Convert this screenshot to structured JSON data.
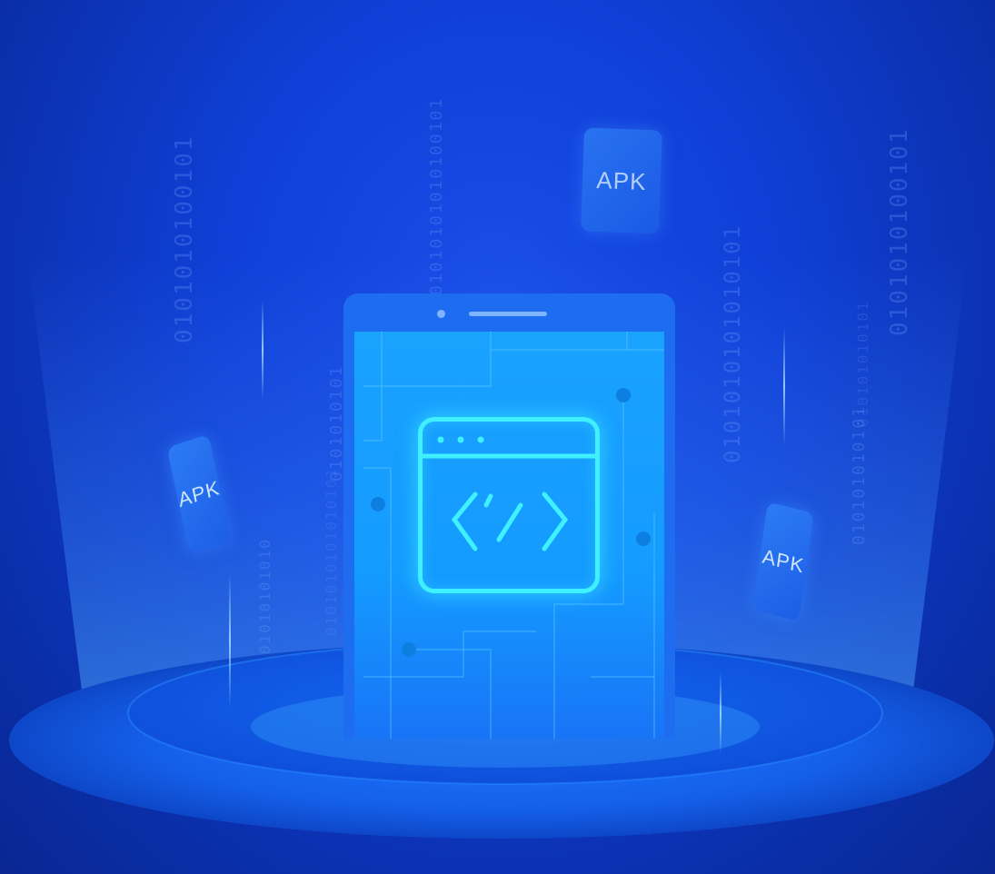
{
  "background": {
    "primary_color": "#0f3fd6",
    "accent_color": "#1aa2ff",
    "glow_color": "#3ff0ff"
  },
  "binary_columns": [
    "0101010100101",
    "01010101010100101",
    "0101010100101",
    "0101010101010101",
    "0101010101",
    "01010101010",
    "010101010101",
    "0101010101010101",
    "010101010101"
  ],
  "apk_cards": [
    {
      "label": "APK"
    },
    {
      "label": "APK"
    },
    {
      "label": "APK"
    }
  ],
  "phone": {
    "icon": "code-window-icon"
  }
}
